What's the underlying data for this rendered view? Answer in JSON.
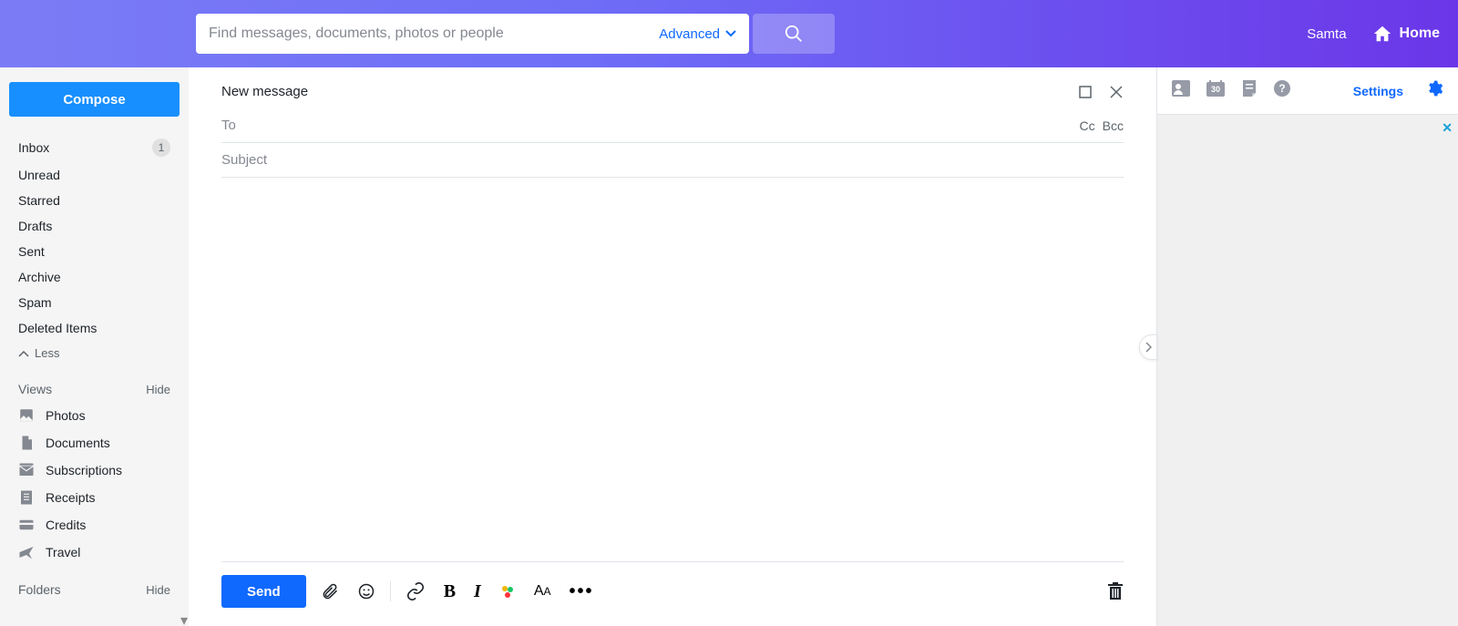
{
  "header": {
    "search_placeholder": "Find messages, documents, photos or people",
    "advanced_label": "Advanced",
    "user_name": "Samta",
    "home_label": "Home"
  },
  "sidebar": {
    "compose_label": "Compose",
    "folders": [
      {
        "label": "Inbox",
        "badge": "1"
      },
      {
        "label": "Unread"
      },
      {
        "label": "Starred"
      },
      {
        "label": "Drafts"
      },
      {
        "label": "Sent"
      },
      {
        "label": "Archive"
      },
      {
        "label": "Spam"
      },
      {
        "label": "Deleted Items"
      }
    ],
    "less_label": "Less",
    "views_label": "Views",
    "views_hide": "Hide",
    "views": [
      {
        "icon": "photo",
        "label": "Photos"
      },
      {
        "icon": "document",
        "label": "Documents"
      },
      {
        "icon": "subscription",
        "label": "Subscriptions"
      },
      {
        "icon": "receipt",
        "label": "Receipts"
      },
      {
        "icon": "credit",
        "label": "Credits"
      },
      {
        "icon": "travel",
        "label": "Travel"
      }
    ],
    "folders_label": "Folders",
    "folders_hide": "Hide"
  },
  "compose": {
    "title": "New message",
    "to_label": "To",
    "cc_label": "Cc",
    "bcc_label": "Bcc",
    "subject_label": "Subject",
    "send_label": "Send"
  },
  "right": {
    "settings_label": "Settings",
    "calendar_day": "30"
  }
}
